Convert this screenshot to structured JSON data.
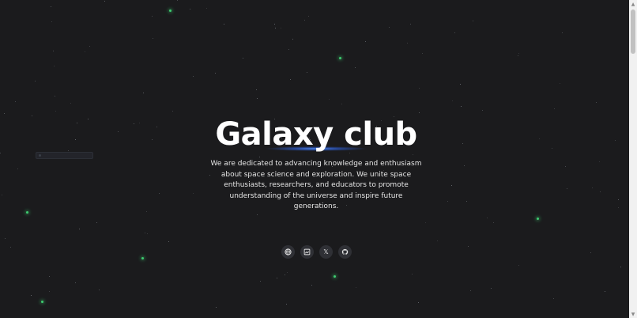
{
  "hero": {
    "title": "Galaxy club",
    "description": "We are dedicated to advancing knowledge and enthusiasm about space science and exploration. We unite space enthusiasts, researchers, and educators to promote understanding of the universe and inspire future generations."
  },
  "socials": [
    {
      "icon": "globe-icon"
    },
    {
      "icon": "image-icon"
    },
    {
      "icon": "x-icon",
      "glyph": "𝕏"
    },
    {
      "icon": "github-icon"
    }
  ],
  "colors": {
    "background": "#1b1b1d",
    "star_green": "#42e07a",
    "glow_blue": "#4a8cff",
    "social_bg": "#2f3035"
  }
}
